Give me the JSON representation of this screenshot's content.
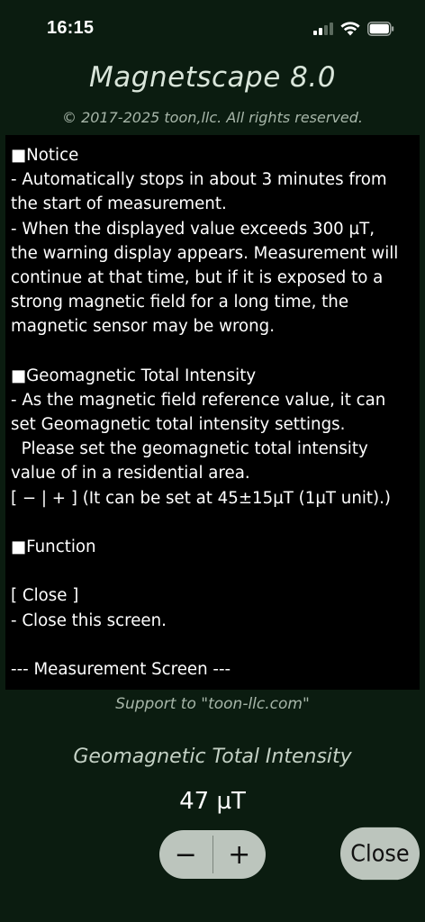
{
  "status_bar": {
    "time": "16:15",
    "icons": [
      "cellular-signal-icon",
      "wifi-icon",
      "battery-icon"
    ]
  },
  "app": {
    "title": "Magnetscape 8.0",
    "copyright": "© 2017-2025 toon,llc. All rights reserved."
  },
  "info_panel": {
    "lines": [
      "■Notice",
      "- Automatically stops in about 3 minutes from",
      "the start of measurement.",
      "- When the displayed value exceeds 300 µT,",
      "the warning display appears. Measurement will",
      "continue at that time, but if it is exposed to a",
      "strong magnetic field for a long time, the",
      "magnetic sensor may be wrong.",
      "",
      "■Geomagnetic Total Intensity",
      "- As the magnetic field reference value, it can",
      "set Geomagnetic total intensity settings.",
      "  Please set the geomagnetic total intensity",
      "value of in a residential area.",
      "[ − | + ] (It can be set at 45±15µT (1µT unit).)",
      "",
      "■Function",
      "",
      "[ Close ]",
      "- Close this screen.",
      "",
      "--- Measurement Screen ---"
    ]
  },
  "support": "Support to \"toon-llc.com\"",
  "geomagnetic": {
    "label": "Geomagnetic Total Intensity",
    "value": "47 µT",
    "minus_label": "−",
    "plus_label": "+"
  },
  "close_label": "Close",
  "colors": {
    "background": "#0b1c10",
    "panel": "#000000",
    "button": "#bcc5bd"
  }
}
